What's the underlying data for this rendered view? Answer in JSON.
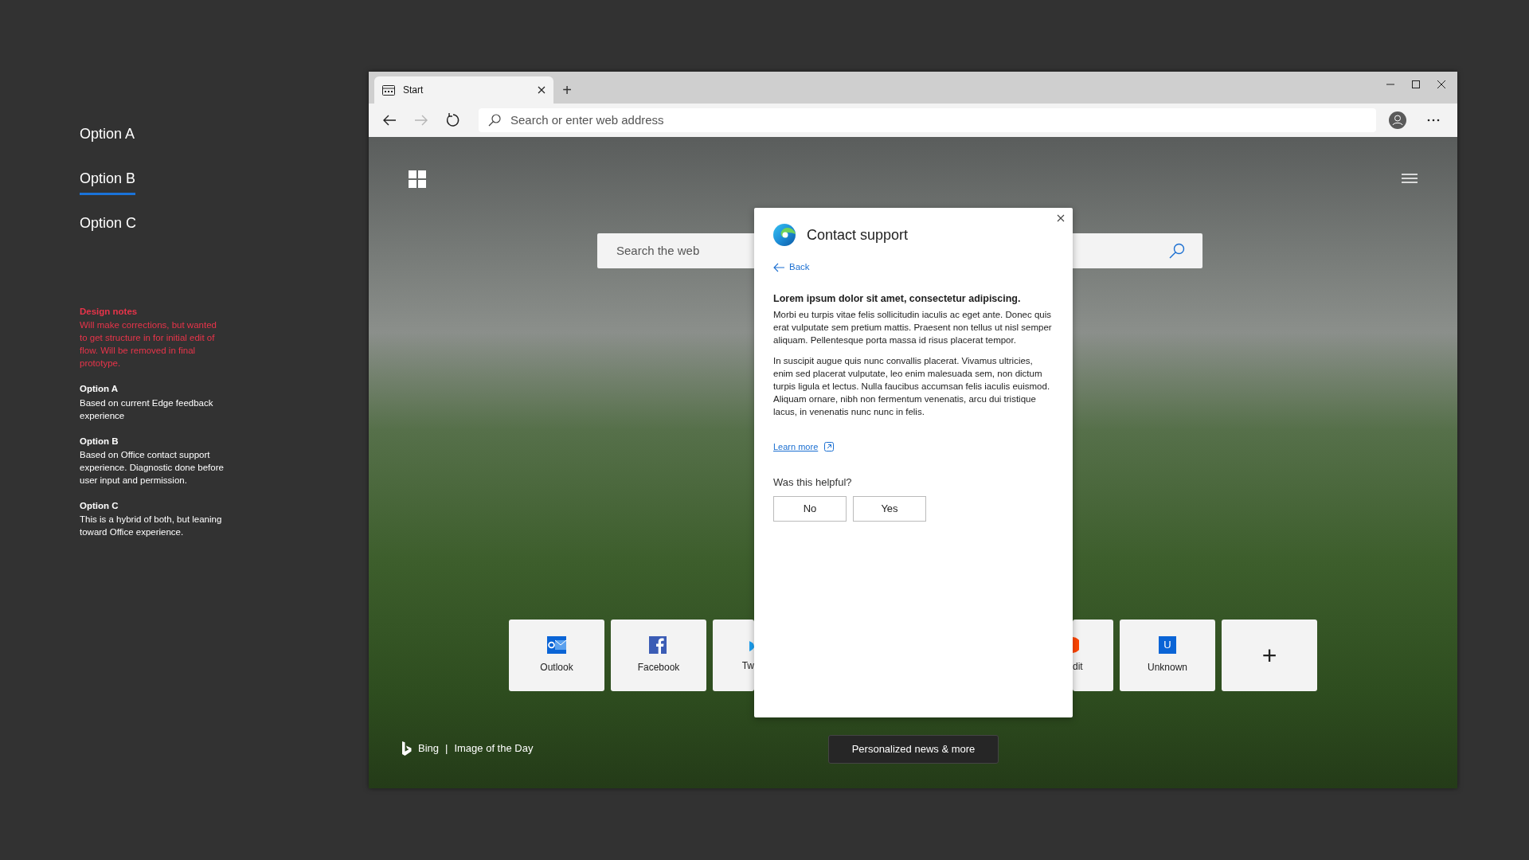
{
  "options_nav": [
    {
      "label": "Option A",
      "selected": false
    },
    {
      "label": "Option B",
      "selected": true
    },
    {
      "label": "Option C",
      "selected": false
    }
  ],
  "design_notes": {
    "title": "Design notes",
    "body": "Will make corrections, but wanted to get structure in for initial edit of flow. Will be removed in final prototype."
  },
  "notes": [
    {
      "title": "Option A",
      "body": "Based on current Edge feedback experience"
    },
    {
      "title": "Option B",
      "body": "Based on Office contact support experience. Diagnostic done before user input and permission."
    },
    {
      "title": "Option C",
      "body": "This is a hybrid of both, but leaning toward Office experience."
    }
  ],
  "browser": {
    "tabs": [
      {
        "label": "Start",
        "selected": true
      }
    ],
    "new_tab": "+",
    "nav_buttons": [
      {
        "kind": "back",
        "disabled": false
      },
      {
        "kind": "forward",
        "disabled": true
      },
      {
        "kind": "refresh",
        "disabled": false
      }
    ],
    "address": {
      "placeholder": "Search or enter web address"
    }
  },
  "start_page": {
    "search": {
      "placeholder": "Search the web"
    },
    "tiles": [
      {
        "kind": "outlook",
        "label": "Outlook"
      },
      {
        "kind": "facebook",
        "label": "Facebook"
      },
      {
        "kind": "partial-left",
        "label": "Tw"
      },
      {
        "kind": "partial-right",
        "label": "dit"
      },
      {
        "kind": "letter",
        "letter": "U",
        "label": "Unknown"
      },
      {
        "kind": "add",
        "label": "+"
      }
    ],
    "credit": {
      "brand": "Bing",
      "separator": "|",
      "caption": "Image of the Day"
    },
    "news_button": "Personalized news & more"
  },
  "dialog": {
    "title": "Contact support",
    "back": "Back",
    "heading": "Lorem ipsum dolor sit amet, consectetur adipiscing.",
    "paragraphs": [
      "Morbi eu turpis vitae felis sollicitudin iaculis ac eget ante. Donec quis erat vulputate sem pretium mattis. Praesent non tellus ut nisl semper aliquam. Pellentesque porta massa id risus placerat tempor.",
      "In suscipit augue quis nunc convallis placerat. Vivamus ultricies, enim sed placerat vulputate, leo enim malesuada sem, non dictum turpis ligula et lectus. Nulla faucibus accumsan felis iaculis euismod. Aliquam ornare, nibh non fermentum venenatis, arcu dui tristique lacus, in venenatis nunc nunc in felis."
    ],
    "learn_more": "Learn more",
    "question": "Was this helpful?",
    "buttons": [
      "No",
      "Yes"
    ]
  }
}
